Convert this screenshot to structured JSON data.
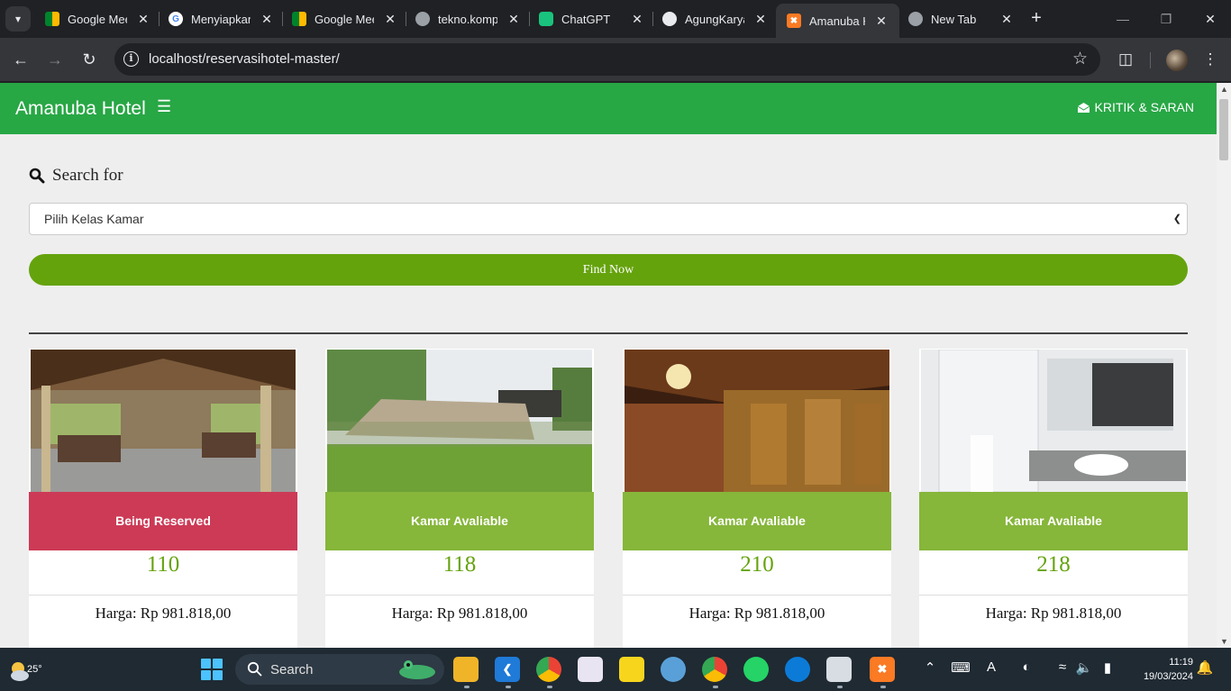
{
  "browser": {
    "tabs": [
      {
        "title": "Google Meet",
        "icon": "google-meet-icon",
        "active": false
      },
      {
        "title": "Menyiapkan",
        "icon": "google-icon",
        "active": false
      },
      {
        "title": "Google Meet",
        "icon": "google-meet-icon",
        "active": false
      },
      {
        "title": "tekno.kompas",
        "icon": "globe-icon",
        "active": false
      },
      {
        "title": "ChatGPT",
        "icon": "chatgpt-icon",
        "active": false
      },
      {
        "title": "AgungKarya",
        "icon": "github-icon",
        "active": false
      },
      {
        "title": "Amanuba Hotel",
        "icon": "xampp-icon",
        "active": true
      },
      {
        "title": "New Tab",
        "icon": "chrome-icon",
        "active": false
      }
    ],
    "url": "localhost/reservasihotel-master/"
  },
  "site": {
    "brand": "Amanuba Hotel",
    "kritik_label": "KRITIK & SARAN",
    "search_heading": "Search for",
    "select_value": "Pilih Kelas Kamar",
    "find_button": "Find Now",
    "accent_color": "#28a745",
    "rooms": [
      {
        "status": "Being Reserved",
        "status_type": "reserved",
        "number": "110",
        "price": "Harga: Rp 981.818,00",
        "image": "pavilion-lounge"
      },
      {
        "status": "Kamar Avaliable",
        "status_type": "available",
        "number": "118",
        "price": "Harga: Rp 981.818,00",
        "image": "garden-amphitheater"
      },
      {
        "status": "Kamar Avaliable",
        "status_type": "available",
        "number": "210",
        "price": "Harga: Rp 981.818,00",
        "image": "carved-wood-hall"
      },
      {
        "status": "Kamar Avaliable",
        "status_type": "available",
        "number": "218",
        "price": "Harga: Rp 981.818,00",
        "image": "marble-bathroom"
      }
    ]
  },
  "taskbar": {
    "weather_temp": "25°",
    "search_label": "Search",
    "time": "11:19",
    "date": "19/03/2024"
  }
}
